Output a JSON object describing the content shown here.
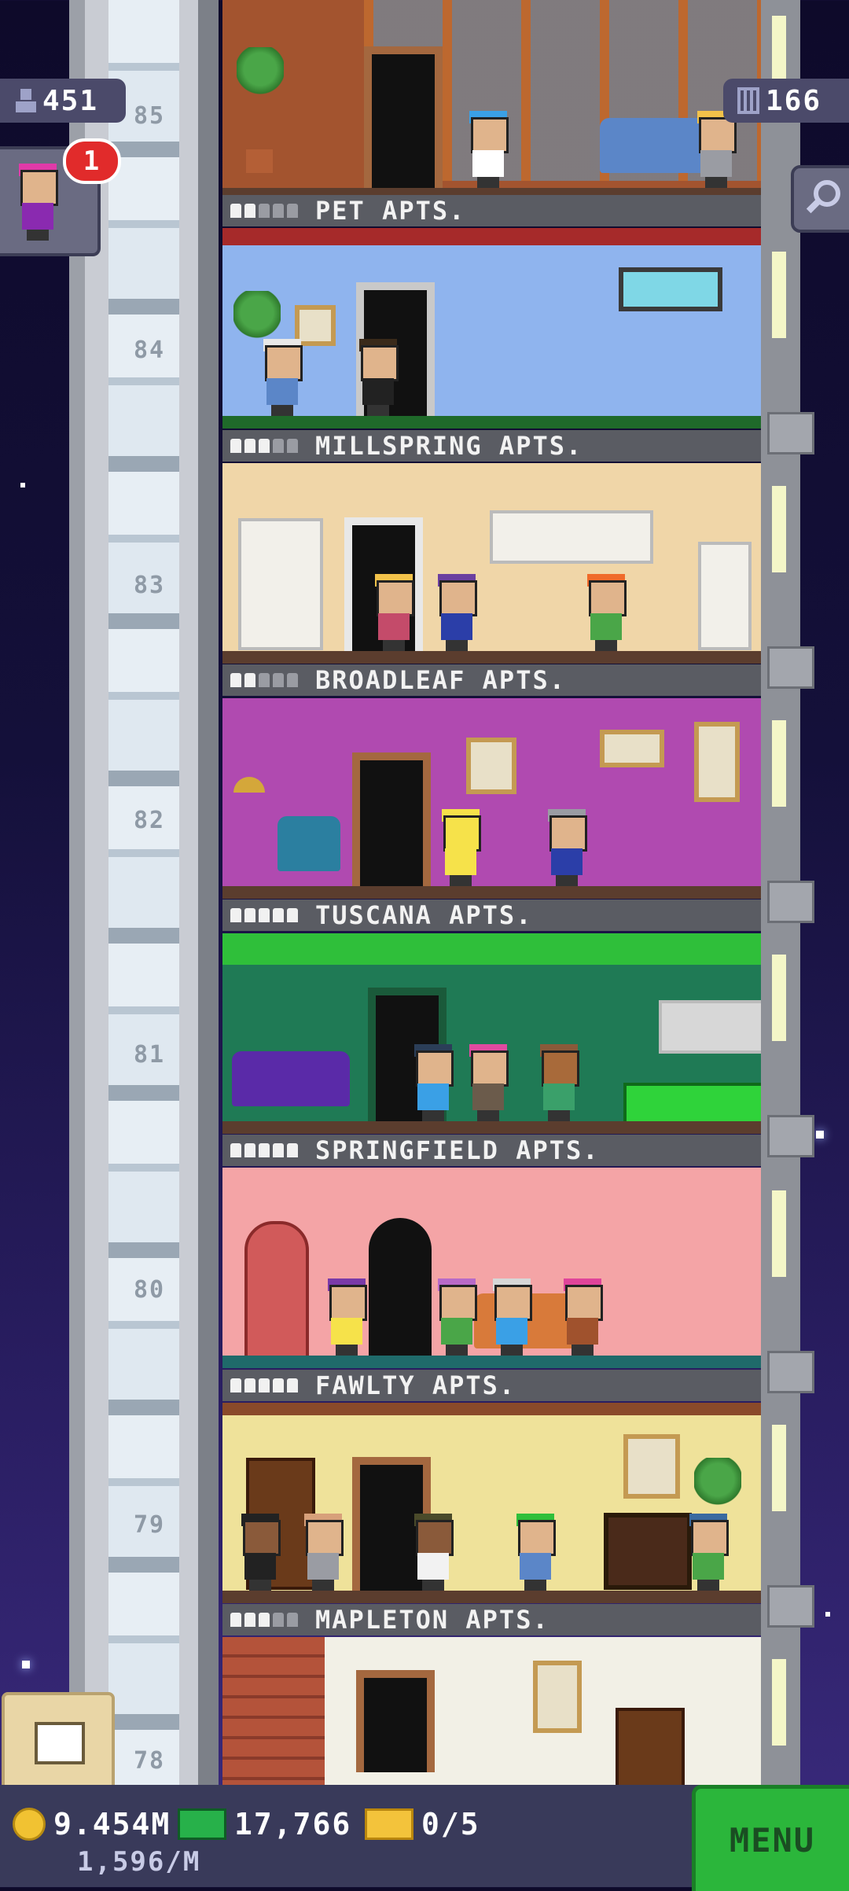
{
  "hud": {
    "population": "451",
    "floor_count": "166",
    "visitor_badge": "1",
    "coins": "9.454M",
    "coin_rate": "1,596/M",
    "bux": "17,766",
    "tickets": "0/5",
    "menu_label": "MENU"
  },
  "floors": [
    {
      "number": "85",
      "name": "PET APTS."
    },
    {
      "number": "84",
      "name": "MILLSPRING APTS."
    },
    {
      "number": "83",
      "name": "BROADLEAF APTS."
    },
    {
      "number": "82",
      "name": "TUSCANA APTS."
    },
    {
      "number": "81",
      "name": "SPRINGFIELD APTS."
    },
    {
      "number": "80",
      "name": "FAWLTY APTS."
    },
    {
      "number": "79",
      "name": "MAPLETON APTS."
    },
    {
      "number": "78",
      "name": ""
    }
  ],
  "icons": [
    "person-icon",
    "building-icon",
    "search-icon",
    "build-icon",
    "coin-icon",
    "bux-icon",
    "ticket-icon"
  ]
}
